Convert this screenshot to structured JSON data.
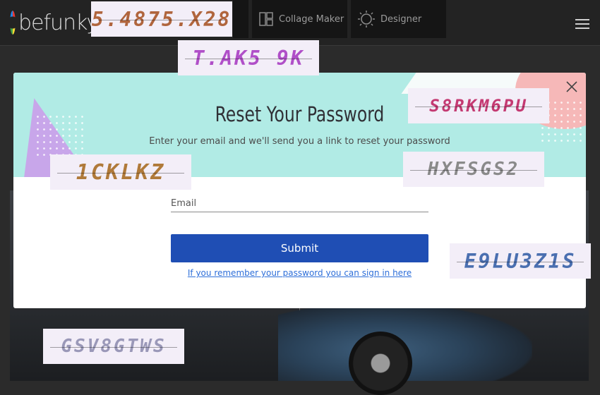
{
  "header": {
    "logo_text": "befunky",
    "nav": [
      {
        "label": "Collage Maker",
        "icon": "collage-icon"
      },
      {
        "label": "Designer",
        "icon": "designer-icon"
      }
    ],
    "menu_icon": "hamburger-icon"
  },
  "modal": {
    "title": "Reset Your Password",
    "subtitle": "Enter your email and we'll send you a link to reset your password",
    "email_placeholder": "Email",
    "submit_label": "Submit",
    "signin_link": "If you remember your password you can sign in here",
    "close_icon": "close-icon"
  },
  "captchas": [
    {
      "text": "5.4875.X28",
      "color": "#b0653d"
    },
    {
      "text": "T.AK5 9K",
      "color": "#b04fc8"
    },
    {
      "text": "S8RKM6PU",
      "color": "#c43a72"
    },
    {
      "text": "1CKLKZ",
      "color": "#b07a3a"
    },
    {
      "text": "HXFSGS2",
      "color": "#8a8a8a"
    },
    {
      "text": "E9LU3Z1S",
      "color": "#4a6fb0"
    },
    {
      "text": "GSV8GTWS",
      "color": "#9a98b8"
    }
  ],
  "colors": {
    "header_bg": "#b1ebe5",
    "submit_bg": "#1f4eb4",
    "link": "#2e6fd9"
  }
}
